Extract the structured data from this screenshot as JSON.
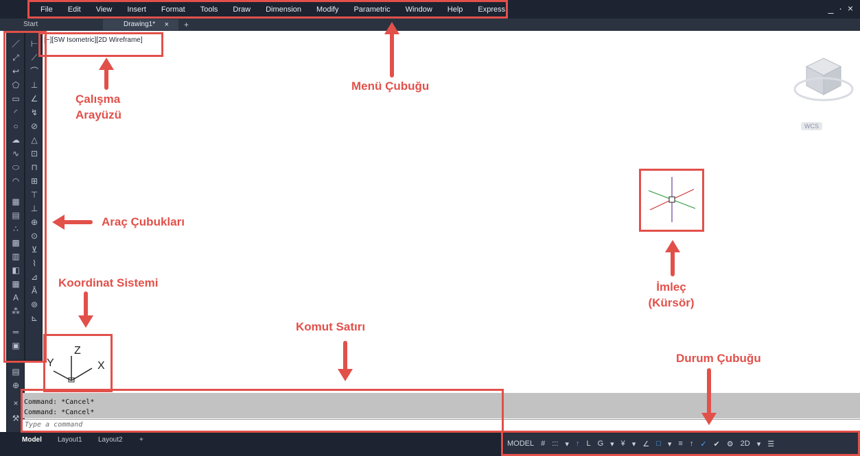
{
  "menu": {
    "items": [
      "File",
      "Edit",
      "View",
      "Insert",
      "Format",
      "Tools",
      "Draw",
      "Dimension",
      "Modify",
      "Parametric",
      "Window",
      "Help",
      "Express"
    ]
  },
  "window_controls": "_ · ×",
  "tabs": {
    "start": "Start",
    "drawing": "Drawing1*",
    "close": "×",
    "add": "+"
  },
  "viewport_label": "[−][SW Isometric][2D Wireframe]",
  "ucs": {
    "x": "X",
    "y": "Y",
    "z": "Z"
  },
  "viewcube": {
    "wcs": "WCS"
  },
  "command": {
    "lines": [
      "Command: *Cancel*",
      "Command: *Cancel*"
    ],
    "placeholder": "Type a command"
  },
  "layout_tabs": {
    "model": "Model",
    "layout1": "Layout1",
    "layout2": "Layout2",
    "add": "+"
  },
  "status_bar": {
    "items": [
      "MODEL",
      "#",
      ":::",
      "▾",
      "↑",
      "L",
      "G",
      "▾",
      "¥",
      "▾",
      "∠",
      "□",
      "▾",
      "≡",
      "↑",
      "✓",
      "✔",
      "⚙",
      "2D",
      "▾",
      "☰"
    ]
  },
  "annotations": {
    "calisma": [
      "Çalışma",
      "Arayüzü"
    ],
    "menu": "Menü Çubuğu",
    "arac": "Araç Çubukları",
    "koordinat": "Koordinat Sistemi",
    "komut": "Komut Satırı",
    "imlec": [
      "İmleç",
      "(Kürsör)"
    ],
    "durum": "Durum Çubuğu"
  },
  "colors": {
    "annotation": "#e2504a",
    "ui_dark": "#1d2330",
    "command_bg": "#c2c2c2"
  }
}
